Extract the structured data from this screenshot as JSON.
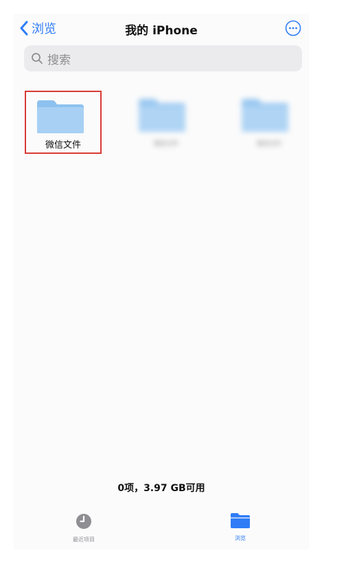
{
  "nav": {
    "back_label": "浏览",
    "title": "我的 iPhone",
    "more_icon": "ellipsis-circle-icon"
  },
  "search": {
    "placeholder": "搜索",
    "icon": "search-icon"
  },
  "files": [
    {
      "name": "微信文件",
      "icon": "folder-icon",
      "selected": true,
      "blurred": false
    },
    {
      "name": "微信文件",
      "icon": "folder-icon",
      "selected": false,
      "blurred": true
    },
    {
      "name": "微信文件",
      "icon": "folder-icon",
      "selected": false,
      "blurred": true
    }
  ],
  "footer": {
    "storage": "0项，3.97 GB可用"
  },
  "tabs": [
    {
      "label": "最近项目",
      "icon": "clock-icon",
      "active": false
    },
    {
      "label": "浏览",
      "icon": "folder-fill-icon",
      "active": true
    }
  ],
  "colors": {
    "accent": "#2f7cf6",
    "folder": "#a7d0f4",
    "folder_tab": "#8dc1ef",
    "selection_border": "#d93a36",
    "inactive_tab": "#8e8e93"
  }
}
